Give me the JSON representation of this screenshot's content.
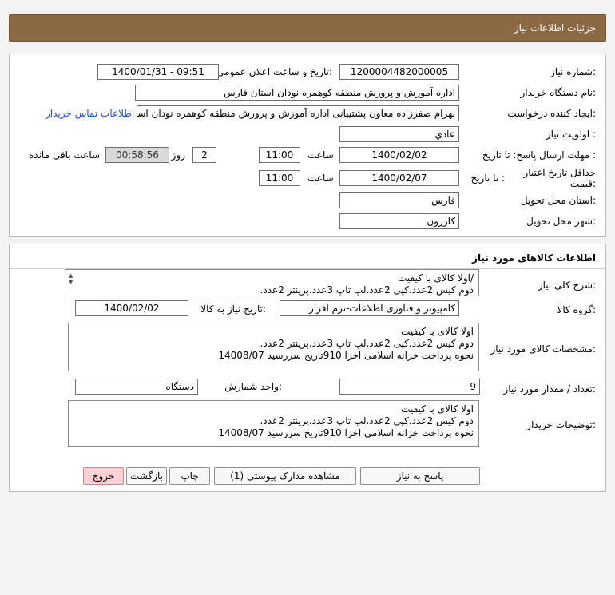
{
  "header": {
    "title": "جزئیات اطلاعات نیاز"
  },
  "info": {
    "need_number_label": "شماره نیاز:",
    "need_number": "1200004482000005",
    "announce_label": "تاریخ و ساعت اعلان عمومی:",
    "announce_value": "1400/01/31 - 09:51",
    "buyer_label": "نام دستگاه خریدار:",
    "buyer_value": "اداره آموزش و پرورش منطقه کوهمره نودان استان فارس",
    "requester_label": "ایجاد کننده درخواست:",
    "requester_value": "بهرام  صفرزاده معاون پشتیبانی اداره آموزش و پرورش منطقه کوهمره نودان استان",
    "contact_link": "اطلاعات تماس خریدار",
    "priority_label": "اولویت نیاز :",
    "priority_value": "عادي",
    "deadline_label": "مهلت ارسال پاسخ: تا تاریخ :",
    "deadline_date": "1400/02/02",
    "time_label": "ساعت",
    "deadline_time": "11:00",
    "days_value": "2",
    "days_label": "روز و",
    "remaining_time": "00:58:56",
    "remaining_label": "ساعت باقی مانده",
    "validity_label": "حداقل تاریخ اعتبار قیمت:",
    "validity_to_label": "تا تاریخ :",
    "validity_date": "1400/02/07",
    "validity_time_label": "ساعت",
    "validity_time": "11:00",
    "province_label": "استان محل تحویل:",
    "province_value": "فارس",
    "city_label": "شهر محل تحویل:",
    "city_value": "کازرون"
  },
  "goods": {
    "section_title": "اطلاعات کالاهای مورد نیاز",
    "desc_label": "شرح کلی نیاز:",
    "desc_lines": [
      "/اولا کالای  با کیفیت",
      "دوم کیس  2عدد.کپی 2عدد.لپ تاپ 3عدد.پرینتر 2عدد."
    ],
    "group_label": "گروه کالا:",
    "group_value": "کامپیوتر و فناوری اطلاعات-نرم افزار",
    "need_date_label": "تاریخ نیاز به کالا:",
    "need_date_value": "1400/02/02",
    "spec_label": "مشخصات کالای مورد نیاز:",
    "spec_lines": [
      "اولا کالای  با کیفیت",
      "دوم کیس  2عدد.کپی 2عدد.لپ تاپ 3عدد.پرینتر 2عدد.",
      "نحوه پرداخت خزانه اسلامی  اخزا 910تاریخ سررسید 14008/07"
    ],
    "qty_label": "تعداد / مقدار مورد نیاز:",
    "qty_value": "9",
    "unit_label": "واحد شمارش:",
    "unit_value": "دستگاه",
    "buyer_notes_label": "توضیحات خریدار:",
    "buyer_notes_lines": [
      "اولا کالای  با کیفیت",
      "دوم کیس  2عدد.کپی 2عدد.لپ تاپ 3عدد.پرینتر 2عدد.",
      "نحوه پرداخت خزانه اسلامی  اخزا 910تاریخ سررسید 14008/07"
    ]
  },
  "buttons": {
    "reply": "پاسخ به نیاز",
    "attachments": "مشاهده مدارک پیوستی (1)",
    "print": "چاپ",
    "back": "بازگشت",
    "exit": "خروج"
  },
  "colors": {
    "header": "#8b6a43",
    "exit_button": "#ffd0d3",
    "link": "#1f4fbf"
  }
}
